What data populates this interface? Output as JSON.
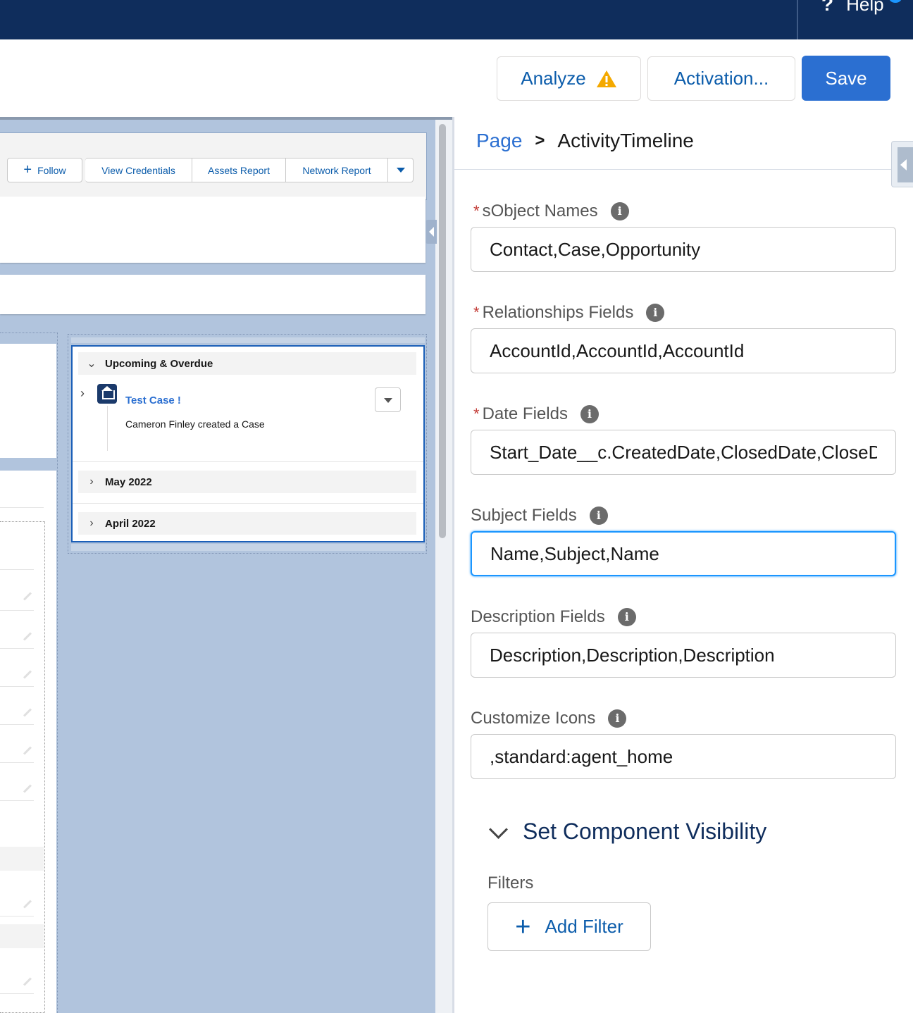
{
  "topnav": {
    "help_label": "Help",
    "help_glyph": "?"
  },
  "header": {
    "analyze_label": "Analyze",
    "activation_label": "Activation...",
    "save_label": "Save"
  },
  "record_header": {
    "buttons": [
      "Follow",
      "View Credentials",
      "Assets Report",
      "Network Report"
    ],
    "follow_glyph": "+"
  },
  "timeline": {
    "sections": [
      {
        "label": "Upcoming & Overdue",
        "expanded": true
      },
      {
        "label": "May 2022",
        "expanded": false
      },
      {
        "label": "April 2022",
        "expanded": false
      }
    ],
    "item": {
      "title": "Test Case !",
      "subtitle": "Cameron Finley created a Case",
      "icon": "home-icon"
    }
  },
  "panel": {
    "breadcrumb": {
      "root": "Page",
      "separator": ">",
      "current": "ActivityTimeline"
    },
    "fields": [
      {
        "label": "sObject Names",
        "required": true,
        "value": "Contact,Case,Opportunity"
      },
      {
        "label": "Relationships Fields",
        "required": true,
        "value": "AccountId,AccountId,AccountId"
      },
      {
        "label": "Date Fields",
        "required": true,
        "value": "Start_Date__c.CreatedDate,ClosedDate,CloseDate"
      },
      {
        "label": "Subject Fields",
        "required": false,
        "value": "Name,Subject,Name"
      },
      {
        "label": "Description Fields",
        "required": false,
        "value": "Description,Description,Description"
      },
      {
        "label": "Customize Icons",
        "required": false,
        "value": ",standard:agent_home"
      }
    ],
    "visibility": {
      "heading": "Set Component Visibility",
      "filters_label": "Filters",
      "add_filter_label": "Add Filter"
    }
  },
  "colors": {
    "nav": "#0f2d5c",
    "brand": "#2b6fd1",
    "canvas": "#b1c4dd",
    "required": "#c23934",
    "warning": "#f4a900"
  }
}
